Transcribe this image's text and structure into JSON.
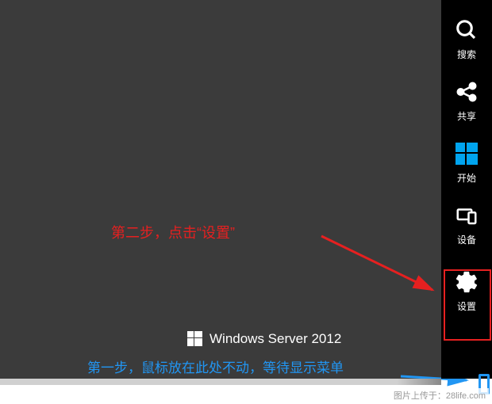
{
  "charms": {
    "search": "搜索",
    "share": "共享",
    "start": "开始",
    "devices": "设备",
    "settings": "设置"
  },
  "annotations": {
    "step2": "第二步，点击“设置”",
    "step1": "第一步，鼠标放在此处不动，等待显示菜单"
  },
  "brand": {
    "text": "Windows Server 2012"
  },
  "watermark": {
    "text": "图片上传于：28life.com"
  }
}
